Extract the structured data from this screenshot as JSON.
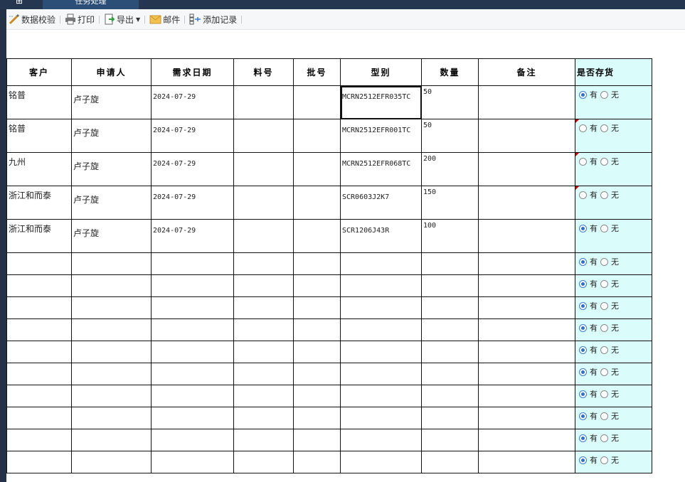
{
  "top_tabs": {
    "home_icon": "home-icon",
    "active_tab_label": "任务处理"
  },
  "toolbar": {
    "items": [
      {
        "label": "数据校验",
        "icon": "pencil-icon"
      },
      {
        "label": "打印",
        "icon": "printer-icon"
      },
      {
        "label": "导出",
        "icon": "export-icon"
      },
      {
        "label": "邮件",
        "icon": "mail-icon"
      },
      {
        "label": "添加记录",
        "icon": "add-record-icon"
      }
    ]
  },
  "grid": {
    "headers": [
      "客户",
      "申请人",
      "需求日期",
      "料号",
      "批号",
      "型别",
      "数量",
      "备注",
      "是否存货"
    ],
    "radio_labels": {
      "yes": "有",
      "no": "无"
    },
    "rows": [
      {
        "customer": "铭普",
        "applicant": "卢子旋",
        "date": "2024-07-29",
        "part_no": "",
        "batch_no": "",
        "model": "MCRN2512EFR035TC",
        "qty": "50",
        "remark": "",
        "in_stock": "有",
        "flagged": false
      },
      {
        "customer": "铭普",
        "applicant": "卢子旋",
        "date": "2024-07-29",
        "part_no": "",
        "batch_no": "",
        "model": "MCRN2512EFR001TC",
        "qty": "50",
        "remark": "",
        "in_stock": "",
        "flagged": true
      },
      {
        "customer": "九州",
        "applicant": "卢子旋",
        "date": "2024-07-29",
        "part_no": "",
        "batch_no": "",
        "model": "MCRN2512EFR068TC",
        "qty": "200",
        "remark": "",
        "in_stock": "",
        "flagged": true
      },
      {
        "customer": "浙江和而泰",
        "applicant": "卢子旋",
        "date": "2024-07-29",
        "part_no": "",
        "batch_no": "",
        "model": "SCR0603J2K7",
        "qty": "150",
        "remark": "",
        "in_stock": "",
        "flagged": true
      },
      {
        "customer": "浙江和而泰",
        "applicant": "卢子旋",
        "date": "2024-07-29",
        "part_no": "",
        "batch_no": "",
        "model": "SCR1206J43R",
        "qty": "100",
        "remark": "",
        "in_stock": "有",
        "flagged": false
      }
    ],
    "empty_rows": 10,
    "empty_row_default": "有"
  }
}
